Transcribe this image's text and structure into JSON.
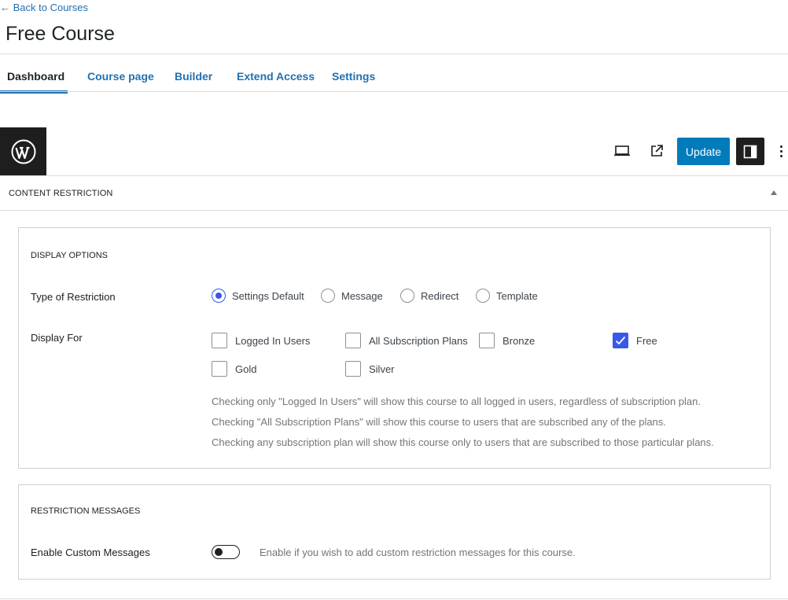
{
  "header": {
    "back_link": "← Back to Courses",
    "title": "Free Course"
  },
  "tabs": [
    {
      "label": "Dashboard",
      "active": true
    },
    {
      "label": "Course page",
      "active": false
    },
    {
      "label": "Builder",
      "active": false
    },
    {
      "label": "Extend Access",
      "active": false
    },
    {
      "label": "Settings",
      "active": false
    }
  ],
  "toolbar": {
    "logo_icon": "wordpress-logo-icon",
    "view_icon": "laptop-icon",
    "preview_icon": "external-link-icon",
    "update_label": "Update",
    "sidebar_icon": "sidebar-toggle-icon",
    "more_icon": "more-vertical-icon"
  },
  "panel": {
    "title": "CONTENT RESTRICTION",
    "collapse_icon": "caret-up-icon"
  },
  "display_options": {
    "title": "DISPLAY OPTIONS",
    "type_label": "Type of Restriction",
    "restriction_types": [
      {
        "label": "Settings Default",
        "checked": true
      },
      {
        "label": "Message",
        "checked": false
      },
      {
        "label": "Redirect",
        "checked": false
      },
      {
        "label": "Template",
        "checked": false
      }
    ],
    "display_for_label": "Display For",
    "display_for": [
      {
        "label": "Logged In Users",
        "checked": false
      },
      {
        "label": "All Subscription Plans",
        "checked": false
      },
      {
        "label": "Bronze",
        "checked": false
      },
      {
        "label": "Free",
        "checked": true
      },
      {
        "label": "Gold",
        "checked": false
      },
      {
        "label": "Silver",
        "checked": false
      }
    ],
    "help_lines": [
      "Checking only \"Logged In Users\" will show this course to all logged in users, regardless of subscription plan.",
      "Checking \"All Subscription Plans\" will show this course to users that are subscribed any of the plans.",
      "Checking any subscription plan will show this course only to users that are subscribed to those particular plans."
    ]
  },
  "restriction_messages": {
    "title": "RESTRICTION MESSAGES",
    "enable_label": "Enable Custom Messages",
    "enabled": false,
    "help": "Enable if you wish to add custom restriction messages for this course."
  },
  "colors": {
    "accent": "#2271b1",
    "update_button": "#007cba",
    "checked": "#3858e9"
  }
}
